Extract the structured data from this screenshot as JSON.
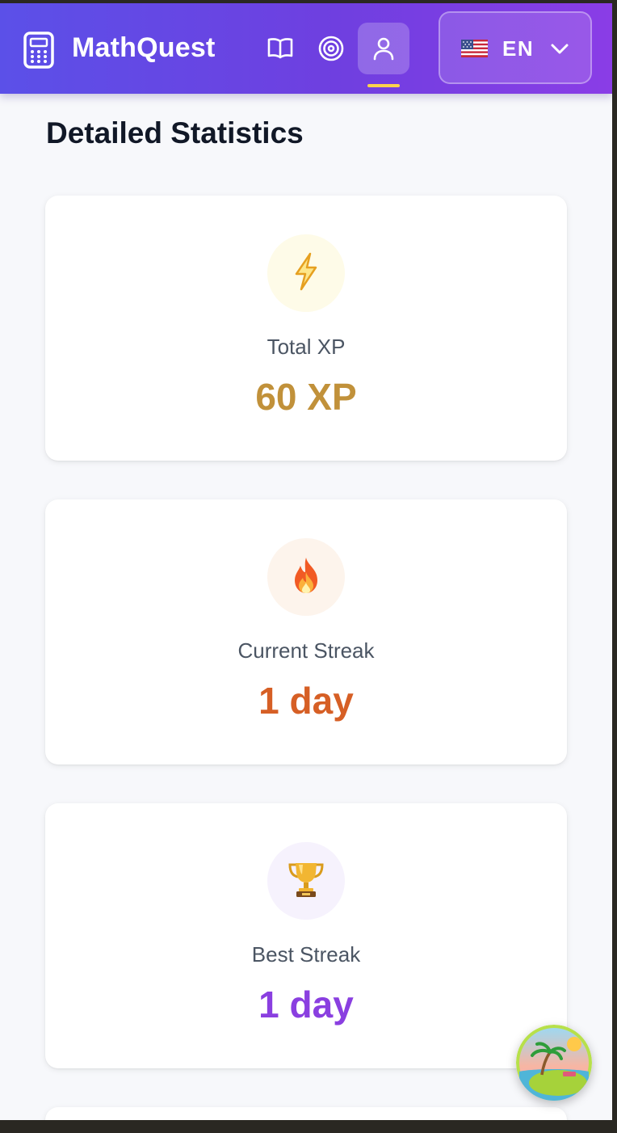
{
  "app": {
    "brand": "MathQuest"
  },
  "nav": {
    "items": [
      {
        "icon": "book-open-icon",
        "active": false
      },
      {
        "icon": "target-icon",
        "active": false
      },
      {
        "icon": "user-icon",
        "active": true
      }
    ],
    "active_indicator_color": "#fcd34d"
  },
  "language": {
    "flag_icon": "us-flag-icon",
    "code": "EN",
    "chevron_icon": "chevron-down-icon"
  },
  "page": {
    "section_title": "Detailed Statistics"
  },
  "stats": [
    {
      "icon": "lightning-icon",
      "label": "Total XP",
      "value": "60 XP",
      "value_color": "#c1913a",
      "circle_bg": "#fefbe8"
    },
    {
      "icon": "fire-icon",
      "label": "Current Streak",
      "value": "1 day",
      "value_color": "#d65f25",
      "circle_bg": "#fdf4ec"
    },
    {
      "icon": "trophy-icon",
      "label": "Best Streak",
      "value": "1 day",
      "value_color": "#8a3fe0",
      "circle_bg": "#f6f2fd"
    }
  ],
  "colors": {
    "header_gradient_start": "#5b50e8",
    "header_gradient_end": "#8a3de6",
    "page_bg": "#f7f8fb",
    "title_text": "#111827",
    "label_text": "#4b5563"
  },
  "floating_button": {
    "icon": "island-avatar-icon"
  }
}
